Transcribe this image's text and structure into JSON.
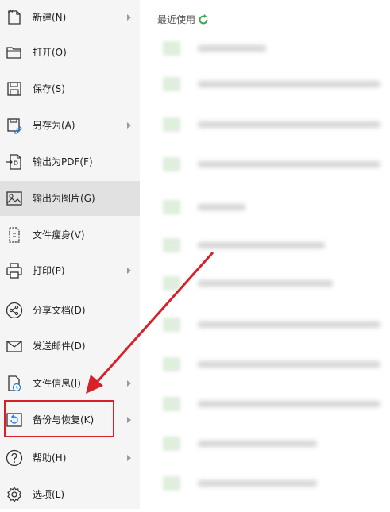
{
  "menu": {
    "items": [
      {
        "label": "新建(N)",
        "icon": "new-file-icon",
        "has_submenu": true
      },
      {
        "label": "打开(O)",
        "icon": "folder-open-icon",
        "has_submenu": false
      },
      {
        "label": "保存(S)",
        "icon": "save-icon",
        "has_submenu": false
      },
      {
        "label": "另存为(A)",
        "icon": "save-as-icon",
        "has_submenu": true
      },
      {
        "label": "输出为PDF(F)",
        "icon": "export-pdf-icon",
        "has_submenu": false
      },
      {
        "label": "输出为图片(G)",
        "icon": "export-image-icon",
        "has_submenu": false,
        "active": true
      },
      {
        "label": "文件瘦身(V)",
        "icon": "file-slim-icon",
        "has_submenu": false
      },
      {
        "label": "打印(P)",
        "icon": "printer-icon",
        "has_submenu": true
      },
      {
        "label": "分享文档(D)",
        "icon": "share-icon",
        "has_submenu": false
      },
      {
        "label": "发送邮件(D)",
        "icon": "mail-icon",
        "has_submenu": false
      },
      {
        "label": "文件信息(I)",
        "icon": "file-info-icon",
        "has_submenu": true
      },
      {
        "label": "备份与恢复(K)",
        "icon": "backup-restore-icon",
        "has_submenu": true,
        "highlighted": true
      },
      {
        "label": "帮助(H)",
        "icon": "help-icon",
        "has_submenu": true
      },
      {
        "label": "选项(L)",
        "icon": "settings-gear-icon",
        "has_submenu": false
      }
    ]
  },
  "recent": {
    "title": "最近使用",
    "refresh_icon": "refresh-icon"
  },
  "colors": {
    "accent_green": "#3aa852",
    "annotation_red": "#d8202a",
    "menu_bg": "#f5f5f5",
    "active_bg": "#e1e1e1"
  }
}
